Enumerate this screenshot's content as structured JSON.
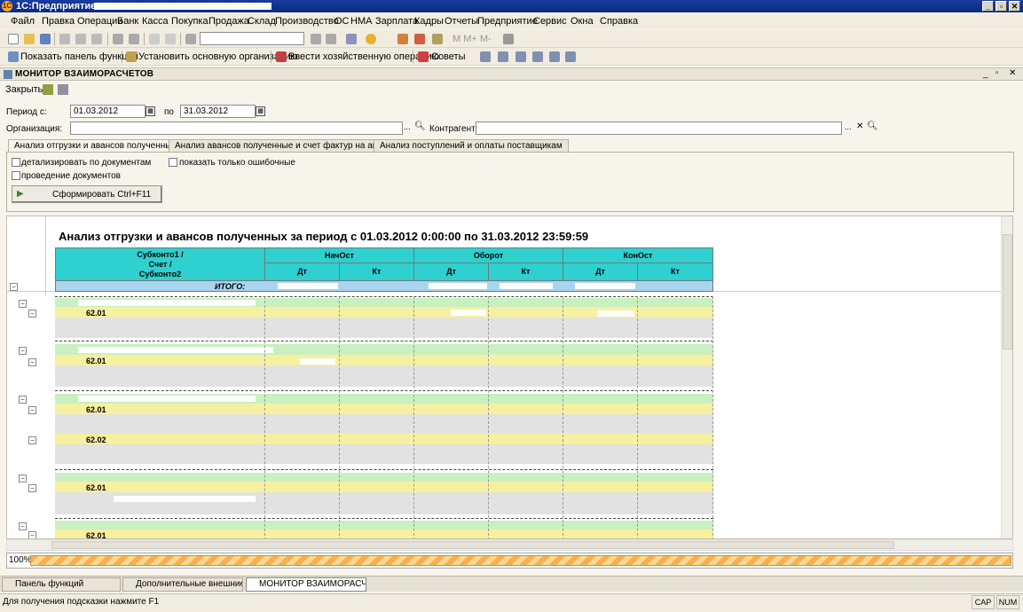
{
  "window": {
    "title": "1С:Предприятие -",
    "min": "_",
    "max": "▫",
    "close": "✕"
  },
  "menu": [
    "Файл",
    "Правка",
    "Операции",
    "Банк",
    "Касса",
    "Покупка",
    "Продажа",
    "Склад",
    "Производство",
    "ОС",
    "НМА",
    "Зарплата",
    "Кадры",
    "Отчеты",
    "Предприятие",
    "Сервис",
    "Окна",
    "Справка"
  ],
  "toolbar2": {
    "panel": "Показать панель функций",
    "org": "Установить основную организацию",
    "op": "Ввести хозяйственную операцию",
    "tips": "Советы"
  },
  "panel": {
    "title": "МОНИТОР ВЗАИМОРАСЧЕТОВ",
    "close_label": "Закрыть"
  },
  "filters": {
    "period_label": "Период с:",
    "date_from": "01.03.2012",
    "to_label": "по",
    "date_to": "31.03.2012",
    "org_label": "Организация:",
    "org_value": "",
    "contr_label": "Контрагент:",
    "contr_value": ""
  },
  "tabs": [
    "Анализ отгрузки и авансов полученные",
    "Анализ авансов полученные и счет фактур на аванс",
    "Анализ поступлений и оплаты поставщикам"
  ],
  "options": {
    "detail": "детализировать по документам",
    "errors": "показать только ошибочные",
    "posting": "проведение документов",
    "run": "Сформировать Ctrl+F11"
  },
  "report": {
    "title": "Анализ отгрузки и авансов полученных за период с 01.03.2012 0:00:00 по 31.03.2012 23:59:59",
    "col_subconto": "Субконто1 / Счет / Субконто2",
    "col_nach": "НачОст",
    "col_obor": "Оборот",
    "col_kon": "КонОст",
    "dt": "Дт",
    "kt": "Кт",
    "total": "ИТОГО:",
    "accounts": [
      "62.01",
      "62.01",
      "62.01",
      "62.02",
      "62.01",
      "62.01"
    ]
  },
  "progress": {
    "label": "100%",
    "value": 100
  },
  "taskbar": [
    "Панель функций",
    "Дополнительные внешние ...",
    "МОНИТОР ВЗАИМОРАСЧЕ..."
  ],
  "status": {
    "hint": "Для получения подсказки нажмите F1",
    "cap": "CAP",
    "num": "NUM"
  }
}
